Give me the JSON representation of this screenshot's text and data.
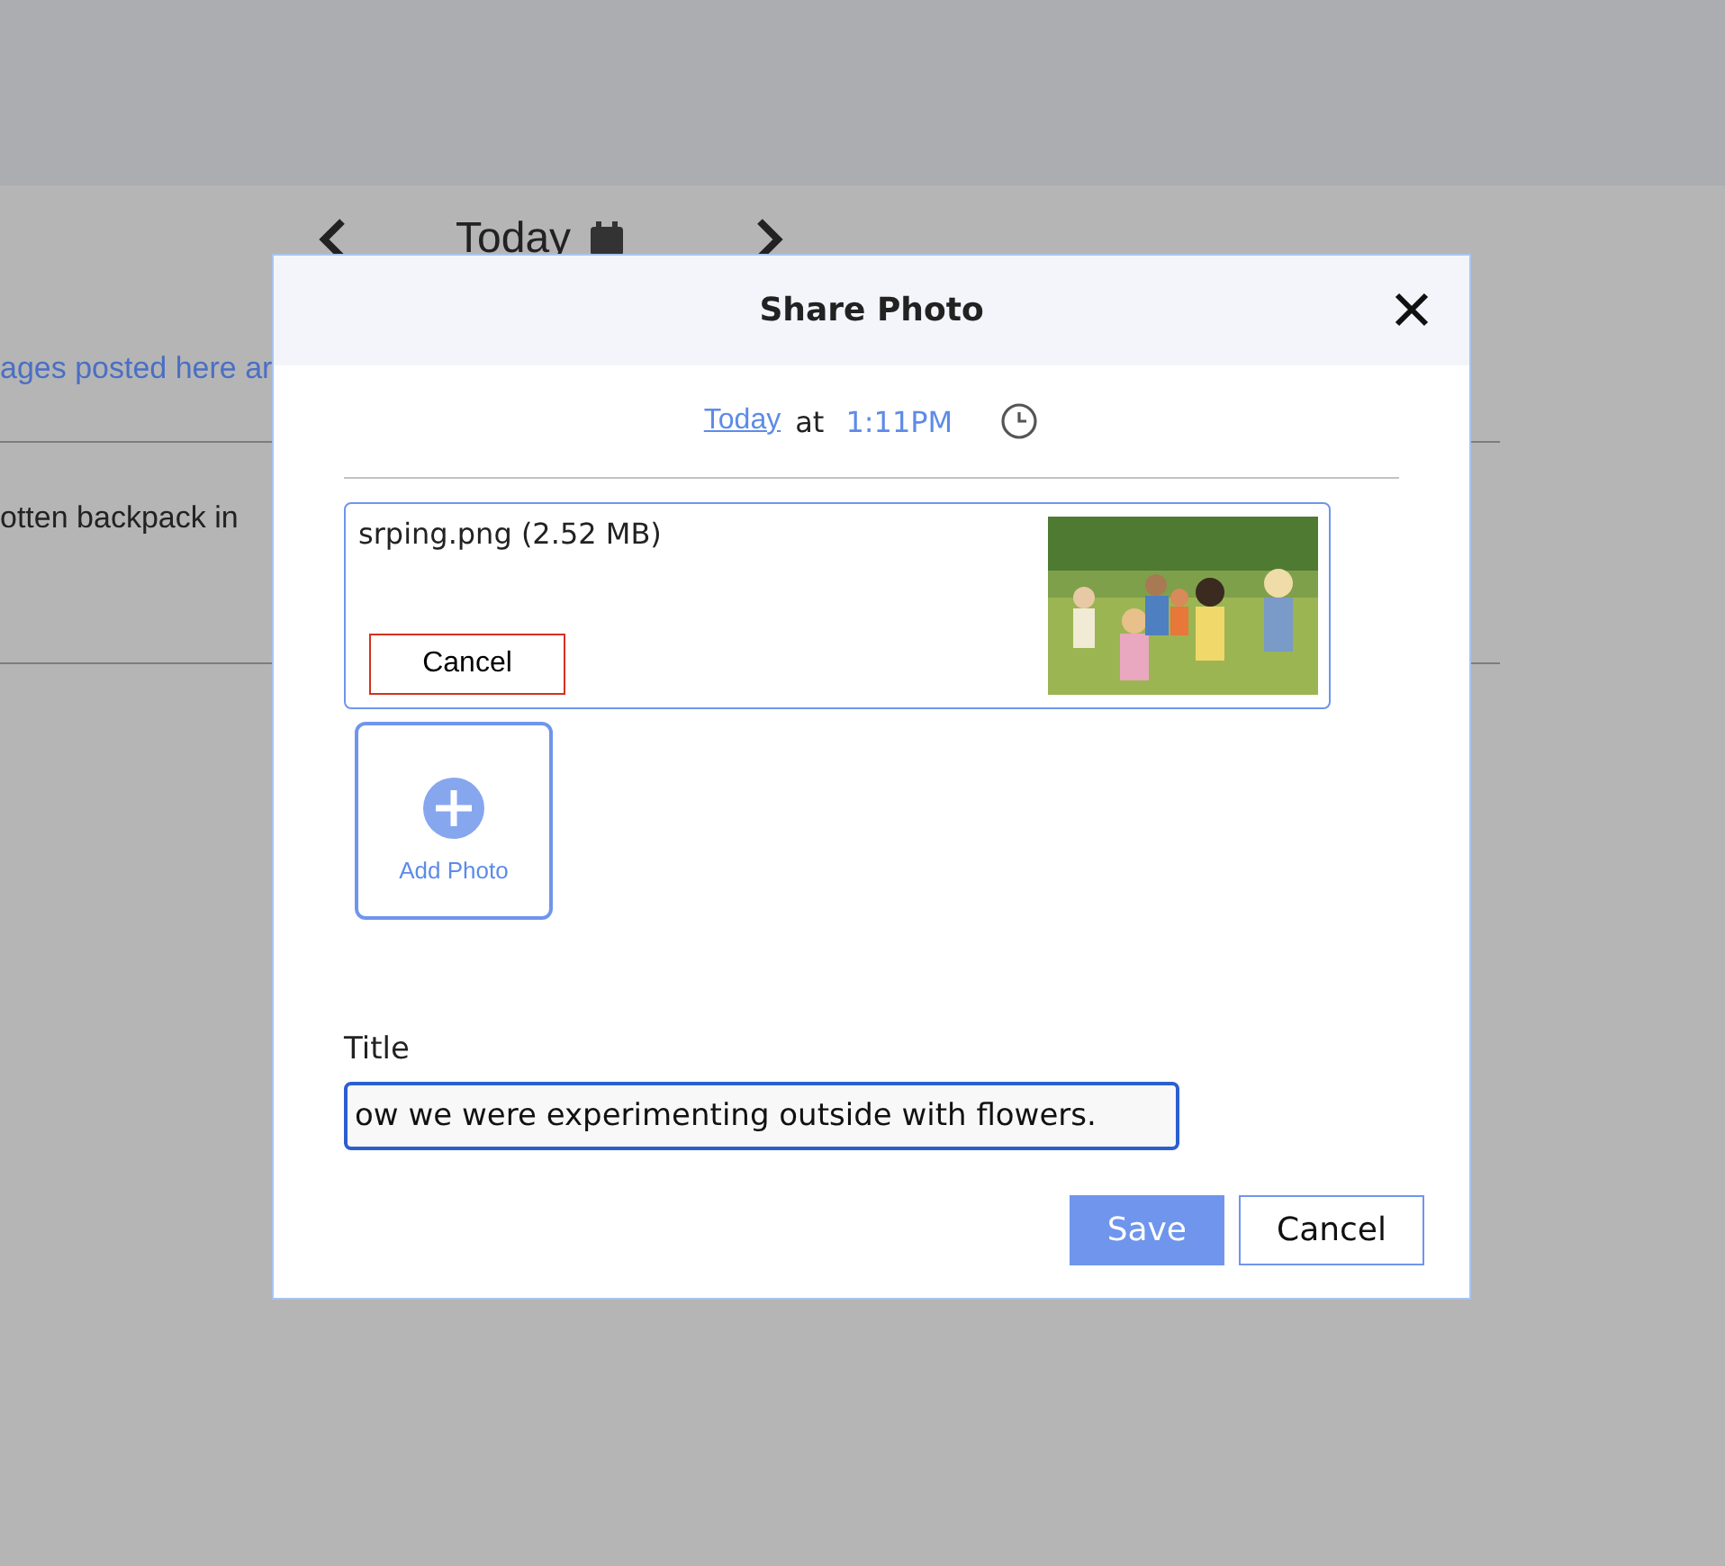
{
  "background": {
    "header_title": "Today",
    "message": "ages posted here ar",
    "post": "otten backpack in"
  },
  "dialog": {
    "title": "Share Photo",
    "time": {
      "date_link": "Today",
      "separator": "at",
      "time": "1:11PM"
    },
    "attachments": [
      {
        "kind": "picture",
        "filename": "srping.png (2.52 MB)",
        "cancel": "Cancel"
      }
    ],
    "add_photo": "Add Photo",
    "title_label": "Title",
    "title_value": "ow we were experimenting outside with flowers.",
    "buttons": [
      {
        "label": "Save",
        "primary": true
      },
      {
        "label": "Cancel",
        "primary": false
      }
    ]
  }
}
